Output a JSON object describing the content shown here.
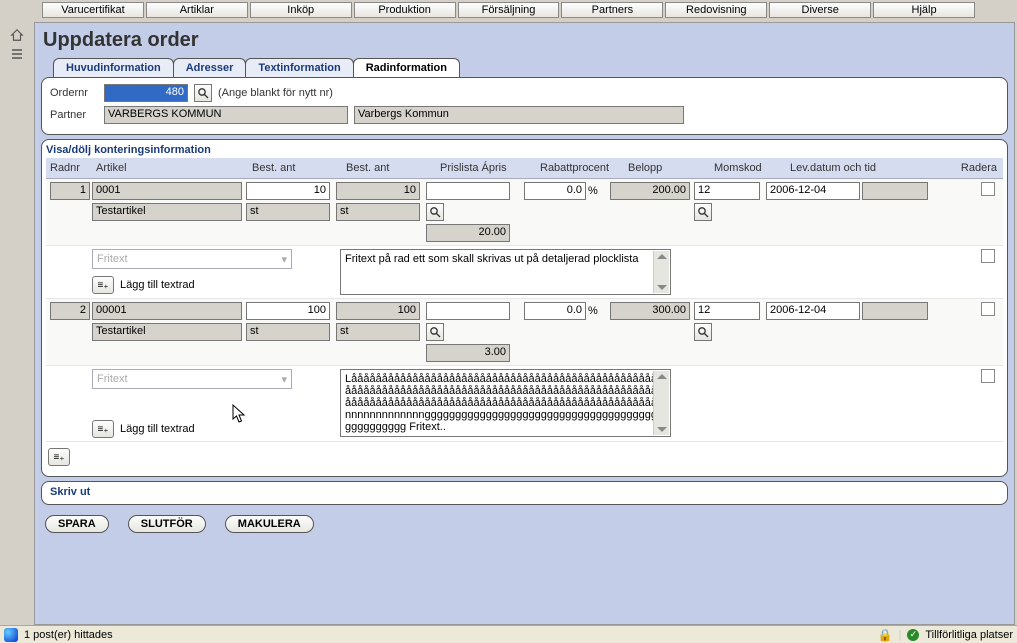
{
  "menu": [
    "Varucertifikat",
    "Artiklar",
    "Inköp",
    "Produktion",
    "Försäljning",
    "Partners",
    "Redovisning",
    "Diverse",
    "Hjälp"
  ],
  "page_title": "Uppdatera order",
  "tabs": [
    {
      "label": "Huvudinformation",
      "active": false
    },
    {
      "label": "Adresser",
      "active": false
    },
    {
      "label": "Textinformation",
      "active": false
    },
    {
      "label": "Radinformation",
      "active": true
    }
  ],
  "order": {
    "ordernr_label": "Ordernr",
    "ordernr": "480",
    "ordernr_hint": "(Ange blankt för nytt nr)",
    "partner_label": "Partner",
    "partner_code": "VARBERGS KOMMUN",
    "partner_name": "Varbergs Kommun"
  },
  "grid": {
    "section_title": "Visa/dölj konteringsinformation",
    "headers": {
      "radnr": "Radnr",
      "artikel": "Artikel",
      "best_ant1": "Best. ant",
      "best_ant2": "Best. ant",
      "prislista": "Prislista Ápris",
      "rabatt": "Rabattprocent",
      "belopp": "Belopp",
      "momskod": "Momskod",
      "levdatum": "Lev.datum och tid",
      "radera": "Radera"
    },
    "fritext_placeholder": "Fritext",
    "addline_label": "Lägg till textrad",
    "rows": [
      {
        "nr": "1",
        "artikel_code": "0001",
        "artikel_name": "Testartikel",
        "ant1": "10",
        "unit1": "st",
        "ant2": "10",
        "unit2": "st",
        "prislista": "",
        "apris": "20.00",
        "rabatt": "0.0",
        "rabatt_unit": "%",
        "belopp": "200.00",
        "momskod": "12",
        "levdatum": "2006-12-04",
        "levtid": "",
        "fritext": "Fritext på rad ett som skall skrivas ut på detaljerad plocklista"
      },
      {
        "nr": "2",
        "artikel_code": "00001",
        "artikel_name": "Testartikel",
        "ant1": "100",
        "unit1": "st",
        "ant2": "100",
        "unit2": "st",
        "prislista": "",
        "apris": "3.00",
        "rabatt": "0.0",
        "rabatt_unit": "%",
        "belopp": "300.00",
        "momskod": "12",
        "levdatum": "2006-12-04",
        "levtid": "",
        "fritext": "Låååååååååååååååååååååååååååååååååååååååååååååååååååååååååååååååååååååååååååååååååååååååååååååååååååååååååååååååååååååååååååååååååååååååååååååååååååååååååånnnnnnnnnnnnnnggggggggggggggggggggggggggggggggggggggggggggggggg Fritext.."
      }
    ]
  },
  "footer": {
    "section_title": "Skriv ut",
    "buttons": {
      "spara": "SPARA",
      "slutfor": "SLUTFÖR",
      "makulera": "MAKULERA"
    }
  },
  "status": {
    "left": "1 post(er) hittades",
    "right": "Tillförlitliga platser"
  }
}
